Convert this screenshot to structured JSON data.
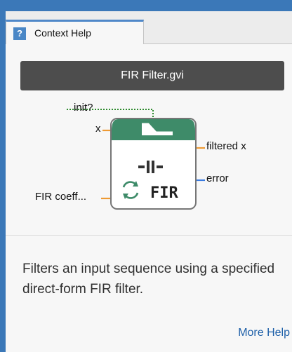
{
  "tab": {
    "label": "Context Help",
    "icon": "help-question-icon",
    "icon_glyph": "?"
  },
  "vi": {
    "title": "FIR Filter.gvi",
    "glyph_text": "FIR",
    "terminals": {
      "init": "init?",
      "x": "x",
      "coefficients": "FIR coeff...",
      "filtered": "filtered x",
      "error": "error"
    }
  },
  "description": "Filters an input sequence using a specified direct-form FIR filter.",
  "more_help": "More Help",
  "colors": {
    "chrome_blue": "#3b78b8",
    "title_bar": "#4d4d4d",
    "vi_header_green": "#3e8b69",
    "wire_orange": "#ee9a33",
    "wire_blue": "#3a7be0",
    "wire_green": "#2e8b2e",
    "link": "#1d5fa8"
  }
}
